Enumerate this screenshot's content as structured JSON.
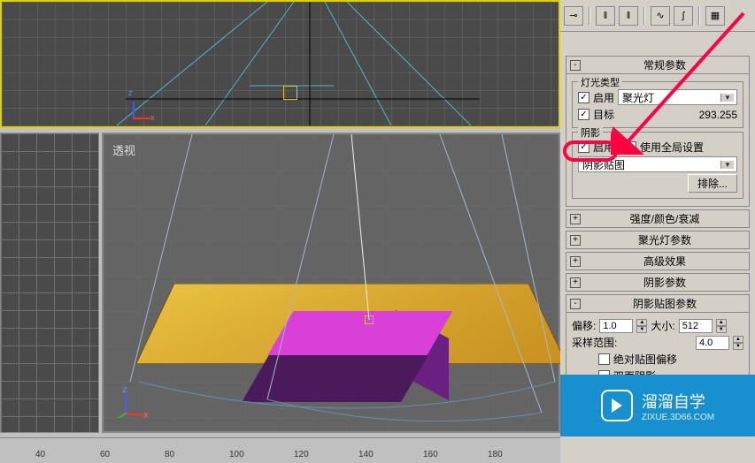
{
  "viewports": {
    "perspective_label": "透视"
  },
  "timeline_ticks": [
    "40",
    "60",
    "80",
    "100",
    "120",
    "140",
    "160",
    "180"
  ],
  "toolbar_icons": [
    "pin",
    "sep",
    "pause-left",
    "pause-right",
    "sep",
    "link",
    "curve",
    "sep",
    "grid"
  ],
  "rollouts": {
    "general": {
      "title": "常规参数",
      "toggle": "-"
    },
    "intensity": {
      "title": "强度/颜色/衰减",
      "toggle": "+"
    },
    "spotlight": {
      "title": "聚光灯参数",
      "toggle": "+"
    },
    "advanced": {
      "title": "高级效果",
      "toggle": "+"
    },
    "shadow_params": {
      "title": "阴影参数",
      "toggle": "+"
    },
    "shadow_map": {
      "title": "阴影贴图参数",
      "toggle": "-"
    }
  },
  "general": {
    "light_type_group": "灯光类型",
    "enable_label": "启用",
    "light_type_value": "聚光灯",
    "target_label": "目标",
    "target_distance": "293.255",
    "shadow_group": "阴影",
    "shadow_enable_label": "启用",
    "global_settings_label": "使用全局设置",
    "shadow_type_value": "阴影贴图",
    "exclude_button": "排除..."
  },
  "shadow_map": {
    "bias_label": "偏移:",
    "bias_value": "1.0",
    "size_label": "大小:",
    "size_value": "512",
    "sample_range_label": "采样范围:",
    "sample_range_value": "4.0",
    "absolute_bias_label": "绝对贴图偏移",
    "two_sided_label": "双面阴影"
  },
  "watermark": {
    "brand": "溜溜自学",
    "url": "ZIXUE.3D66.COM"
  }
}
